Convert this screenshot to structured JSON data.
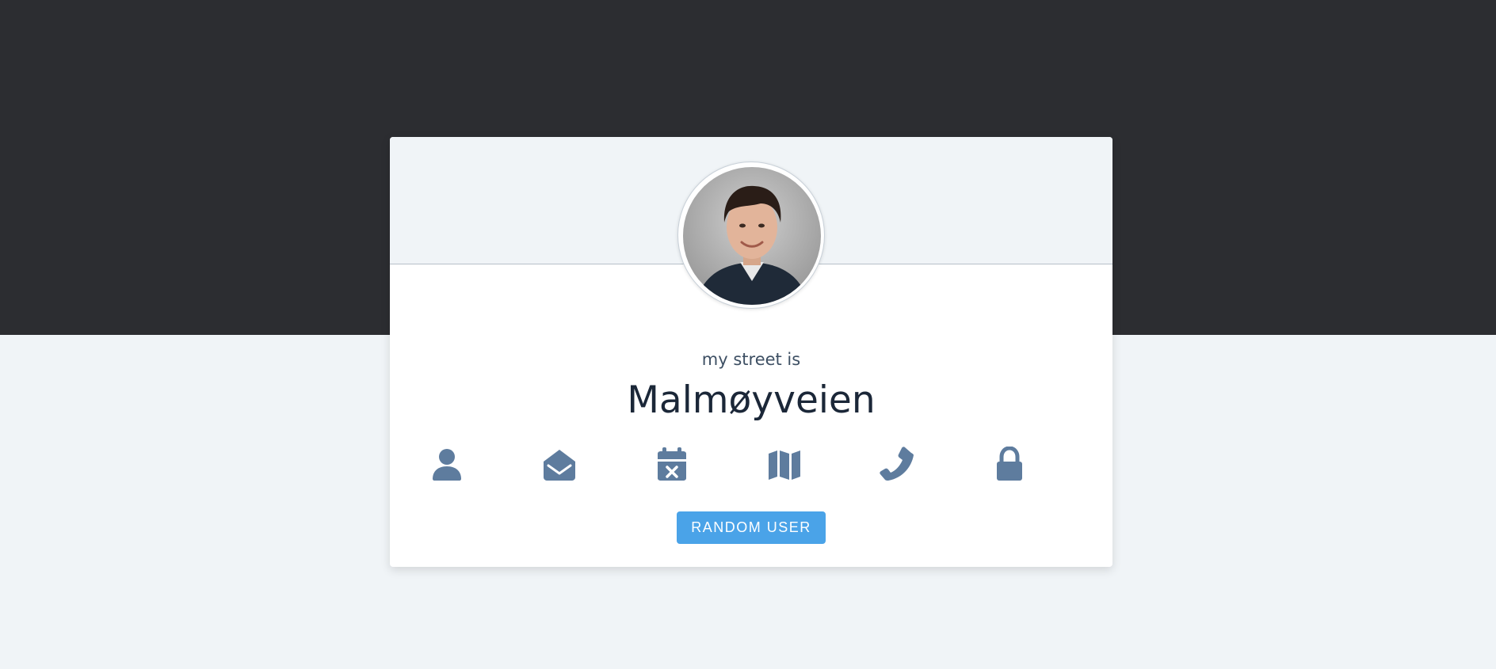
{
  "profile": {
    "label": "my street is",
    "value": "Malmøyveien"
  },
  "icons": [
    "user-icon",
    "envelope-open-icon",
    "calendar-x-icon",
    "map-icon",
    "phone-icon",
    "lock-icon"
  ],
  "button": {
    "label": "RANDOM USER"
  },
  "colors": {
    "dark_band": "#2c2d31",
    "page_bg": "#f0f4f7",
    "card_bg": "#ffffff",
    "icon": "#5e7c9e",
    "button": "#4aa3e8"
  }
}
